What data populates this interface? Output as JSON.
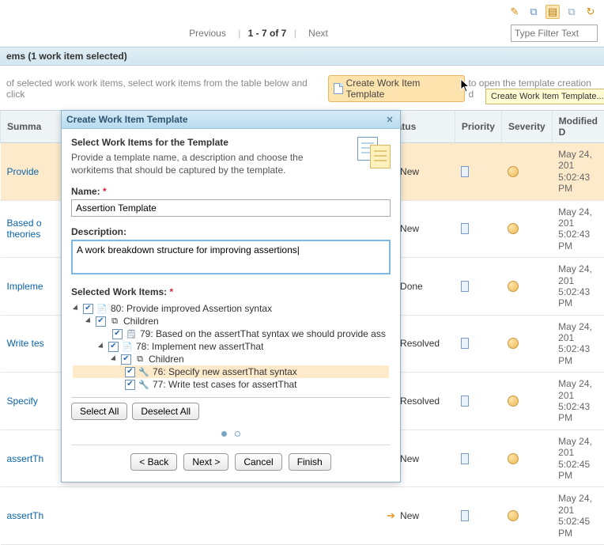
{
  "toolbar": {
    "icons": [
      {
        "name": "pencil-icon",
        "glyph": "✎"
      },
      {
        "name": "copy-icon",
        "glyph": "⧉"
      },
      {
        "name": "template-icon",
        "glyph": "▤",
        "active": true
      },
      {
        "name": "clone-icon",
        "glyph": "⧉"
      },
      {
        "name": "refresh-icon",
        "glyph": "↻"
      }
    ]
  },
  "pager": {
    "prev": "Previous",
    "range": "1 - 7 of 7",
    "next": "Next"
  },
  "filter": {
    "placeholder": "Type Filter Text"
  },
  "banner": "ems (1 work item selected)",
  "instruction": {
    "before": "of selected work work items, select work items from the table below and click",
    "button": "Create Work Item Template",
    "after": "to open the template creation d",
    "tooltip": "Create Work Item Template..."
  },
  "table": {
    "headers": {
      "summary": "Summa",
      "status": "Status",
      "priority": "Priority",
      "severity": "Severity",
      "modified": "Modified D"
    },
    "rows": [
      {
        "summary": "Provide",
        "status": "New",
        "arrow": "orange",
        "date": "May 24, 201",
        "time": "5:02:43 PM",
        "selected": true
      },
      {
        "summary": "Based o theories",
        "status": "New",
        "arrow": "orange",
        "date": "May 24, 201",
        "time": "5:02:43 PM",
        "multiline": true
      },
      {
        "summary": "Impleme",
        "status": "Done",
        "arrow": "green",
        "date": "May 24, 201",
        "time": "5:02:43 PM"
      },
      {
        "summary": "Write tes",
        "status": "Resolved",
        "arrow": "green",
        "date": "May 24, 201",
        "time": "5:02:43 PM"
      },
      {
        "summary": "Specify",
        "status": "Resolved",
        "arrow": "green",
        "date": "May 24, 201",
        "time": "5:02:43 PM"
      },
      {
        "summary": "assertTh",
        "status": "New",
        "arrow": "orange",
        "date": "May 24, 201",
        "time": "5:02:45 PM"
      },
      {
        "summary": "assertTh",
        "status": "New",
        "arrow": "orange",
        "date": "May 24, 201",
        "time": "5:02:45 PM"
      }
    ]
  },
  "dialog": {
    "title": "Create Work Item Template",
    "subheading": "Select Work Items for the Template",
    "description": "Provide a template name, a description and choose the workitems that should be captured by the template.",
    "name_label": "Name:",
    "name_value": "Assertion Template",
    "desc_label": "Description:",
    "desc_value": "A work breakdown structure for improving assertions",
    "selected_label": "Selected Work Items:",
    "tree": [
      {
        "indent": 0,
        "twisty": true,
        "type": "story",
        "text": "80: Provide improved Assertion syntax"
      },
      {
        "indent": 1,
        "twisty": true,
        "type": "children",
        "text": "Children"
      },
      {
        "indent": 2,
        "twisty": false,
        "type": "plan",
        "text": "79: Based on the assertThat syntax we should provide ass"
      },
      {
        "indent": 2,
        "twisty": true,
        "type": "story",
        "text": "78: Implement new assertThat"
      },
      {
        "indent": 3,
        "twisty": true,
        "type": "children",
        "text": "Children"
      },
      {
        "indent": 3,
        "twisty": false,
        "type": "task",
        "text": "76: Specify new assertThat syntax",
        "selected": true
      },
      {
        "indent": 3,
        "twisty": false,
        "type": "task",
        "text": "77: Write test cases for assertThat"
      }
    ],
    "select_all": "Select All",
    "deselect_all": "Deselect All",
    "back": "< Back",
    "next": "Next >",
    "cancel": "Cancel",
    "finish": "Finish"
  }
}
